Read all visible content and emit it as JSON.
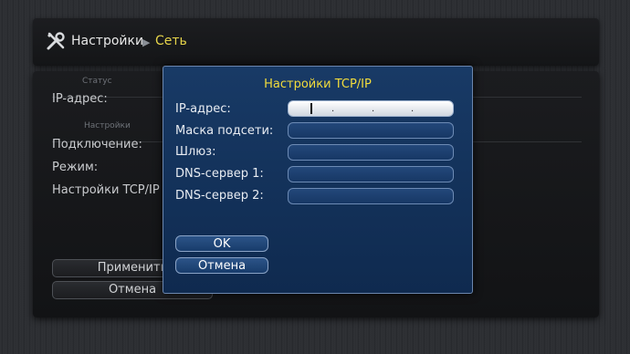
{
  "breadcrumb": {
    "root": "Настройки",
    "separator": "▶",
    "current": "Сеть"
  },
  "background_panel": {
    "status_section": "Статус",
    "ip_label": "IP-адрес:",
    "settings_section": "Настройки",
    "connection_label": "Подключение:",
    "mode_label": "Режим:",
    "tcpip_label": "Настройки TCP/IP",
    "apply_button": "Применить",
    "cancel_button": "Отмена"
  },
  "dialog": {
    "title": "Настройки TCP/IP",
    "fields": [
      {
        "label": "IP-адрес:",
        "value": ""
      },
      {
        "label": "Маска подсети:",
        "value": ""
      },
      {
        "label": "Шлюз:",
        "value": ""
      },
      {
        "label": "DNS-сервер 1:",
        "value": ""
      },
      {
        "label": "DNS-сервер 2:",
        "value": ""
      }
    ],
    "ip_separator": ".",
    "ok_button": "OK",
    "cancel_button": "Отмена"
  },
  "colors": {
    "accent_yellow": "#e6d44a",
    "dialog_blue": "#183a66",
    "field_border": "#6d8bb5"
  },
  "icons": {
    "header": "wrench-screwdriver-icon",
    "breadcrumb_separator": "triangle-right-icon"
  }
}
